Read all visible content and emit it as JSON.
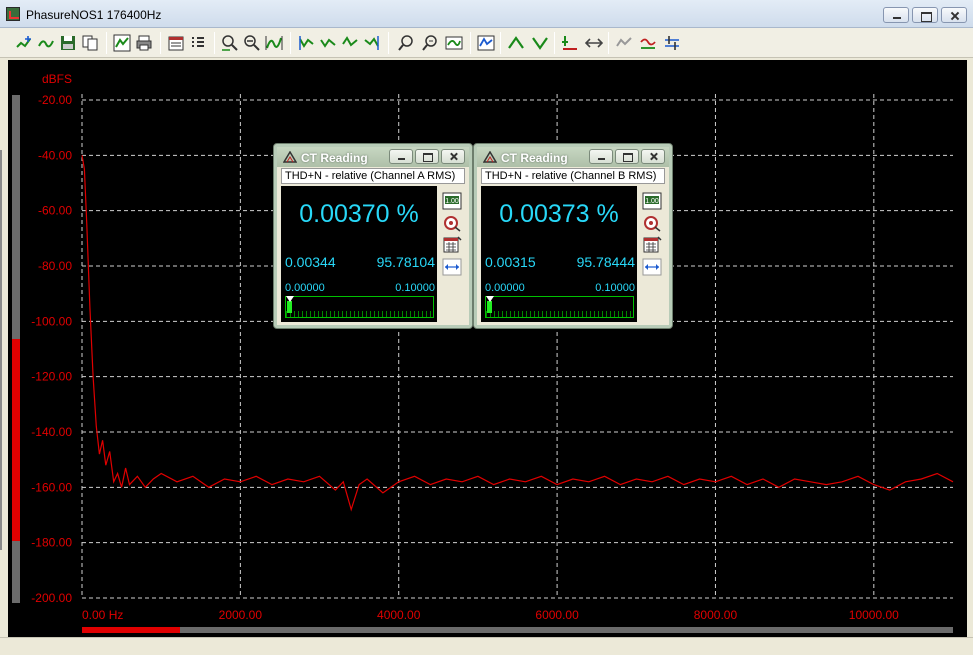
{
  "window": {
    "title": "PhasureNOS1 176400Hz"
  },
  "toolbar": {
    "icons": [
      "trace-add-icon",
      "trace-smooth-icon",
      "save-icon",
      "copy-icon",
      "spectrum-icon",
      "print-icon",
      "properties-icon",
      "data-icon",
      "zoom-in-icon",
      "zoom-out-icon",
      "zoom-fit-icon",
      "marker-left-icon",
      "marker-next-icon",
      "marker-prev-icon",
      "marker-right-icon",
      "zoom-x-icon",
      "zoom-y-icon",
      "autoscale-icon",
      "cursor-icon",
      "peak-icon",
      "trough-icon",
      "reference-icon",
      "arrows-icon",
      "offset-icon",
      "compare-icon",
      "settings-icon"
    ]
  },
  "chart_data": {
    "type": "line",
    "ylabel": "dBFS",
    "ylim": [
      -200,
      -20
    ],
    "yticks": [
      "-20.00",
      "-40.00",
      "-60.00",
      "-80.00",
      "-100.00",
      "-120.00",
      "-140.00",
      "-160.00",
      "-180.00",
      "-200.00"
    ],
    "xlim": [
      0,
      11000
    ],
    "xticks": [
      "0.00 Hz",
      "2000.00",
      "4000.00",
      "6000.00",
      "8000.00",
      "10000.00"
    ],
    "grid": true,
    "series": [
      {
        "color": "#e00000",
        "x": [
          0,
          30,
          60,
          100,
          140,
          180,
          220,
          260,
          300,
          350,
          400,
          450,
          500,
          550,
          600,
          700,
          800,
          900,
          1000,
          1200,
          1400,
          1600,
          1800,
          2000,
          2200,
          2400,
          2600,
          2800,
          3000,
          3200,
          3300,
          3400,
          3500,
          3600,
          3800,
          4000,
          4200,
          4400,
          4600,
          4800,
          5000,
          5200,
          5400,
          5600,
          5800,
          6000,
          6200,
          6400,
          6600,
          6800,
          7000,
          7200,
          7400,
          7600,
          7800,
          8000,
          8200,
          8400,
          8600,
          8800,
          9000,
          9200,
          9400,
          9600,
          9800,
          10000,
          10200,
          10400,
          10600,
          10800,
          11000
        ],
        "y": [
          -40,
          -45,
          -65,
          -95,
          -120,
          -138,
          -148,
          -143,
          -152,
          -147,
          -158,
          -155,
          -160,
          -153,
          -159,
          -156,
          -160,
          -157,
          -155,
          -158,
          -156,
          -160,
          -157,
          -158,
          -156,
          -159,
          -157,
          -158,
          -156,
          -161,
          -158,
          -168,
          -159,
          -157,
          -162,
          -158,
          -156,
          -159,
          -157,
          -158,
          -156,
          -159,
          -157,
          -158,
          -156,
          -159,
          -157,
          -158,
          -156,
          -159,
          -157,
          -158,
          -156,
          -159,
          -157,
          -158,
          -156,
          -159,
          -157,
          -160,
          -157,
          -158,
          -159,
          -158,
          -156,
          -159,
          -161,
          -158,
          -157,
          -155,
          -158
        ]
      }
    ]
  },
  "ct_a": {
    "title": "CT Reading",
    "subtitle": "THD+N - relative (Channel A RMS)",
    "main_value": "0.00370 %",
    "val1": "0.00344",
    "val2": "95.78104",
    "scale_min": "0.00000",
    "scale_max": "0.10000",
    "level": 0.037
  },
  "ct_b": {
    "title": "CT Reading",
    "subtitle": "THD+N - relative (Channel B RMS)",
    "main_value": "0.00373 %",
    "val1": "0.00315",
    "val2": "95.78444",
    "scale_min": "0.00000",
    "scale_max": "0.10000",
    "level": 0.0373
  },
  "ct_side_icons": [
    "digits-icon",
    "target-icon",
    "calculator-icon",
    "resize-arrows-icon"
  ],
  "colors": {
    "trace": "#e00000",
    "reading": "#28d8f8",
    "meter": "#00c000"
  }
}
